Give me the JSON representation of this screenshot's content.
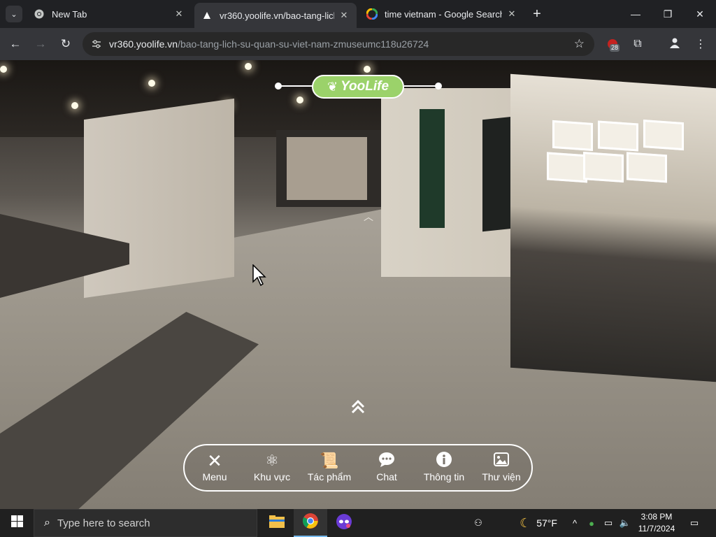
{
  "browser": {
    "tabs": [
      {
        "title": "New Tab",
        "favicon": "chrome-icon",
        "active": false
      },
      {
        "title": "vr360.yoolife.vn/bao-tang-lich-",
        "favicon": "triangle-icon",
        "active": true
      },
      {
        "title": "time vietnam - Google Search",
        "favicon": "google-icon",
        "active": false
      }
    ],
    "url_host": "vr360.yoolife.vn",
    "url_path": "/bao-tang-lich-su-quan-su-viet-nam-zmuseumc118u26724",
    "extension_badge": "28"
  },
  "tour": {
    "logo_text": "YooLife",
    "menu": [
      {
        "label": "Menu",
        "icon": "close-icon"
      },
      {
        "label": "Khu vực",
        "icon": "atom-icon"
      },
      {
        "label": "Tác phẩm",
        "icon": "scroll-icon"
      },
      {
        "label": "Chat",
        "icon": "chat-icon"
      },
      {
        "label": "Thông tin",
        "icon": "info-icon"
      },
      {
        "label": "Thư viện",
        "icon": "gallery-icon"
      }
    ]
  },
  "taskbar": {
    "search_placeholder": "Type here to search",
    "weather": "57°F",
    "time": "3:08 PM",
    "date": "11/7/2024"
  },
  "colors": {
    "logo_green": "#9bd26a",
    "chrome_dark": "#202124",
    "toolbar": "#35363a"
  }
}
